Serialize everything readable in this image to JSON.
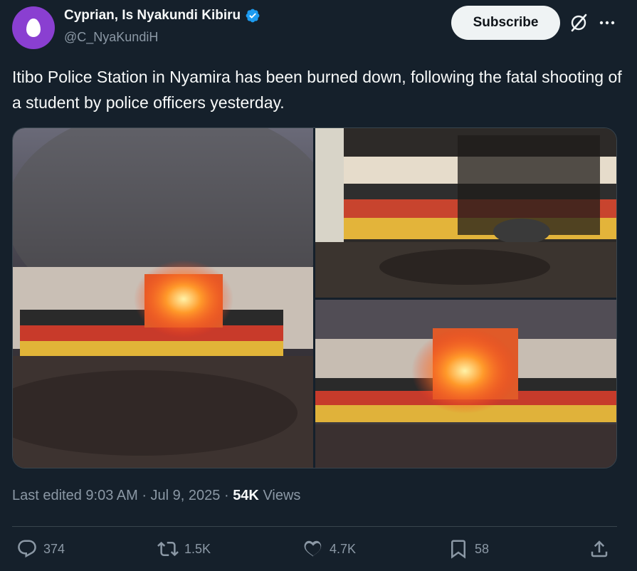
{
  "author": {
    "display_name": "Cyprian, Is Nyakundi Kibiru",
    "handle": "@C_NyaKundiH",
    "verified": true,
    "avatar_color": "#8a3fd1"
  },
  "header": {
    "subscribe_label": "Subscribe",
    "icons": [
      "grok-icon",
      "more-icon"
    ]
  },
  "tweet": {
    "text": "Itibo Police Station in Nyamira has been burned down, following the fatal shooting of a student by police officers yesterday."
  },
  "media": {
    "count": 3
  },
  "meta": {
    "edited_label": "Last edited 9:03 AM · Jul 9, 2025 · ",
    "views_count": "54K",
    "views_label": " Views"
  },
  "actions": {
    "replies": "374",
    "reposts": "1.5K",
    "likes": "4.7K",
    "bookmarks": "58"
  },
  "colors": {
    "background": "#15202b",
    "text": "#f7f9f9",
    "muted": "#8b98a5",
    "verified": "#1d9bf0",
    "border": "#38444d"
  }
}
